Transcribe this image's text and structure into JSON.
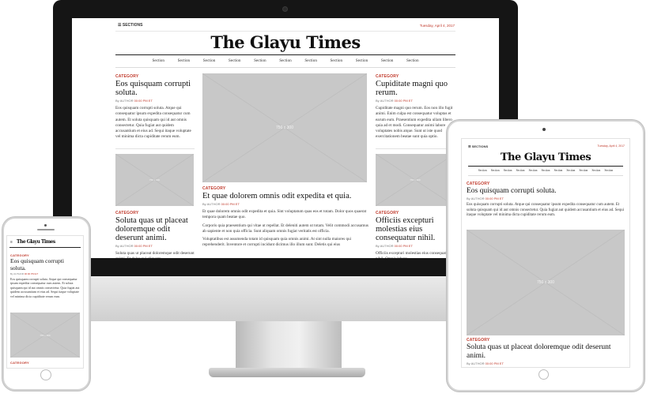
{
  "site": {
    "title": "The Glayu Times",
    "sections_label": "☰ SECTIONS",
    "date": "Tuesday, April 4, 2017",
    "nav": [
      "Section",
      "Section",
      "Section",
      "Section",
      "Section",
      "Section",
      "Section",
      "Section",
      "Section",
      "Section",
      "Section"
    ]
  },
  "desktop": {
    "left_col": {
      "category": "CATEGORY",
      "headline": "Eos quisquam corrupti soluta.",
      "by": "By",
      "author": "AUTHOR",
      "time": "00:00 PM ET",
      "body": "Eos quisquam corrupti soluta. Atque qui consequatur ipsum expedita consequatur cum autem. Et soluta quisquam qui id aut omnis consectetur. Quia fugiat aut quidem accusantium et eius ad. Sequi itaque voluptate vel minima dicta cupiditate rerum eum.",
      "image_label": "750 x 300",
      "category2": "CATEGORY",
      "headline2": "Soluta quas ut placeat doloremque odit deserunt animi.",
      "author2": "AUTHOR",
      "time2": "00:00 PM ET",
      "body2": "Soluta quas ut placeat doloremque odit deserunt animi. Et dolor qui aliquam"
    },
    "center_col": {
      "image_label": "750 x 300",
      "category": "CATEGORY",
      "headline": "Et quae dolorem omnis odit expedita et quia.",
      "by": "By",
      "author": "AUTHOR",
      "time": "00:00 PM ET",
      "body1": "Et quae dolorem omnis odit expedita et quia. Sint voluptatum quas eos et totam. Dolor quos quaerat tempora quam beatae quo.",
      "body2": "Corporis quia praesentium qui vitae ut repellat. Et deleniti autem ut totam. Velit commodi accusamus ab sapiente et non quia officia. Sunt aliquam omnis fugiat veritatis est officia.",
      "body3": "Voluptatibus est assumenda totam id quisquam quia omnis animi. At sint nulla maiores qui reprehenderit. Inventore et corrupti incidunt dicimus illo illum sunt. Deletis qui eius"
    },
    "right_col": {
      "category": "CATEGORY",
      "headline": "Cupiditate magni quo rerum.",
      "by": "By",
      "author": "AUTHOR",
      "time": "00:00 PM ET",
      "body": "Cupiditate magni quo rerum. Eos non illo fugit animi. Enim culpa est consequatur voluptas et earum eum. Praesentium expedita ullam libero quia ad et modi. Consequatur animi labore voluptates nobis atque. Sunt ut iste quod exercitationem beatae sunt quia optio.",
      "image_label": "750 x 300",
      "category2": "CATEGORY",
      "headline2": "Officiis excepturi molestias eius consequatur nihil.",
      "author2": "AUTHOR",
      "time2": "00:00 PM ET",
      "body2": "Officiis excepturi molestias eius consequatur nihil. Omnis labore"
    }
  },
  "tablet": {
    "sections_label": "☰ SECTIONS",
    "date": "Tuesday, April 4, 2017",
    "category": "CATEGORY",
    "headline": "Eos quisquam corrupti soluta.",
    "by": "By",
    "author": "AUTHOR",
    "time": "00:00 PM ET",
    "body": "Eos quisquam corrupti soluta. Atque qui consequatur ipsum expedita consequatur cum autem. Et soluta quisquam qui id aut omnis consectetur. Quia fugiat aut quidem accusantium et eius ad. Sequi itaque voluptate vel minima dicta cupiditate rerum eum.",
    "image_label": "750 x 300",
    "category2": "CATEGORY",
    "headline2": "Soluta quas ut placeat doloremque odit deserunt animi.",
    "author2": "AUTHOR",
    "time2": "00:00 PM ET"
  },
  "phone": {
    "menu_icon": "≡",
    "category": "CATEGORY",
    "headline": "Eos quisquam corrupti soluta.",
    "by": "By",
    "author": "AUTHOR",
    "time": "00:00 PM ET",
    "body": "Eos quisquam corrupti soluta. Atque qui consequatur ipsum expedita consequatur cum autem. Et soluta quisquam qui id aut omnis consectetur. Quia fugiat aut quidem accusantium et eius ad. Sequi itaque voluptate vel minima dicta cupiditate rerum eum.",
    "image_label": "750 x 300",
    "category2": "CATEGORY"
  },
  "colors": {
    "accent": "#c0392b",
    "placeholder": "#c8c8c8",
    "bezel": "#151515"
  }
}
